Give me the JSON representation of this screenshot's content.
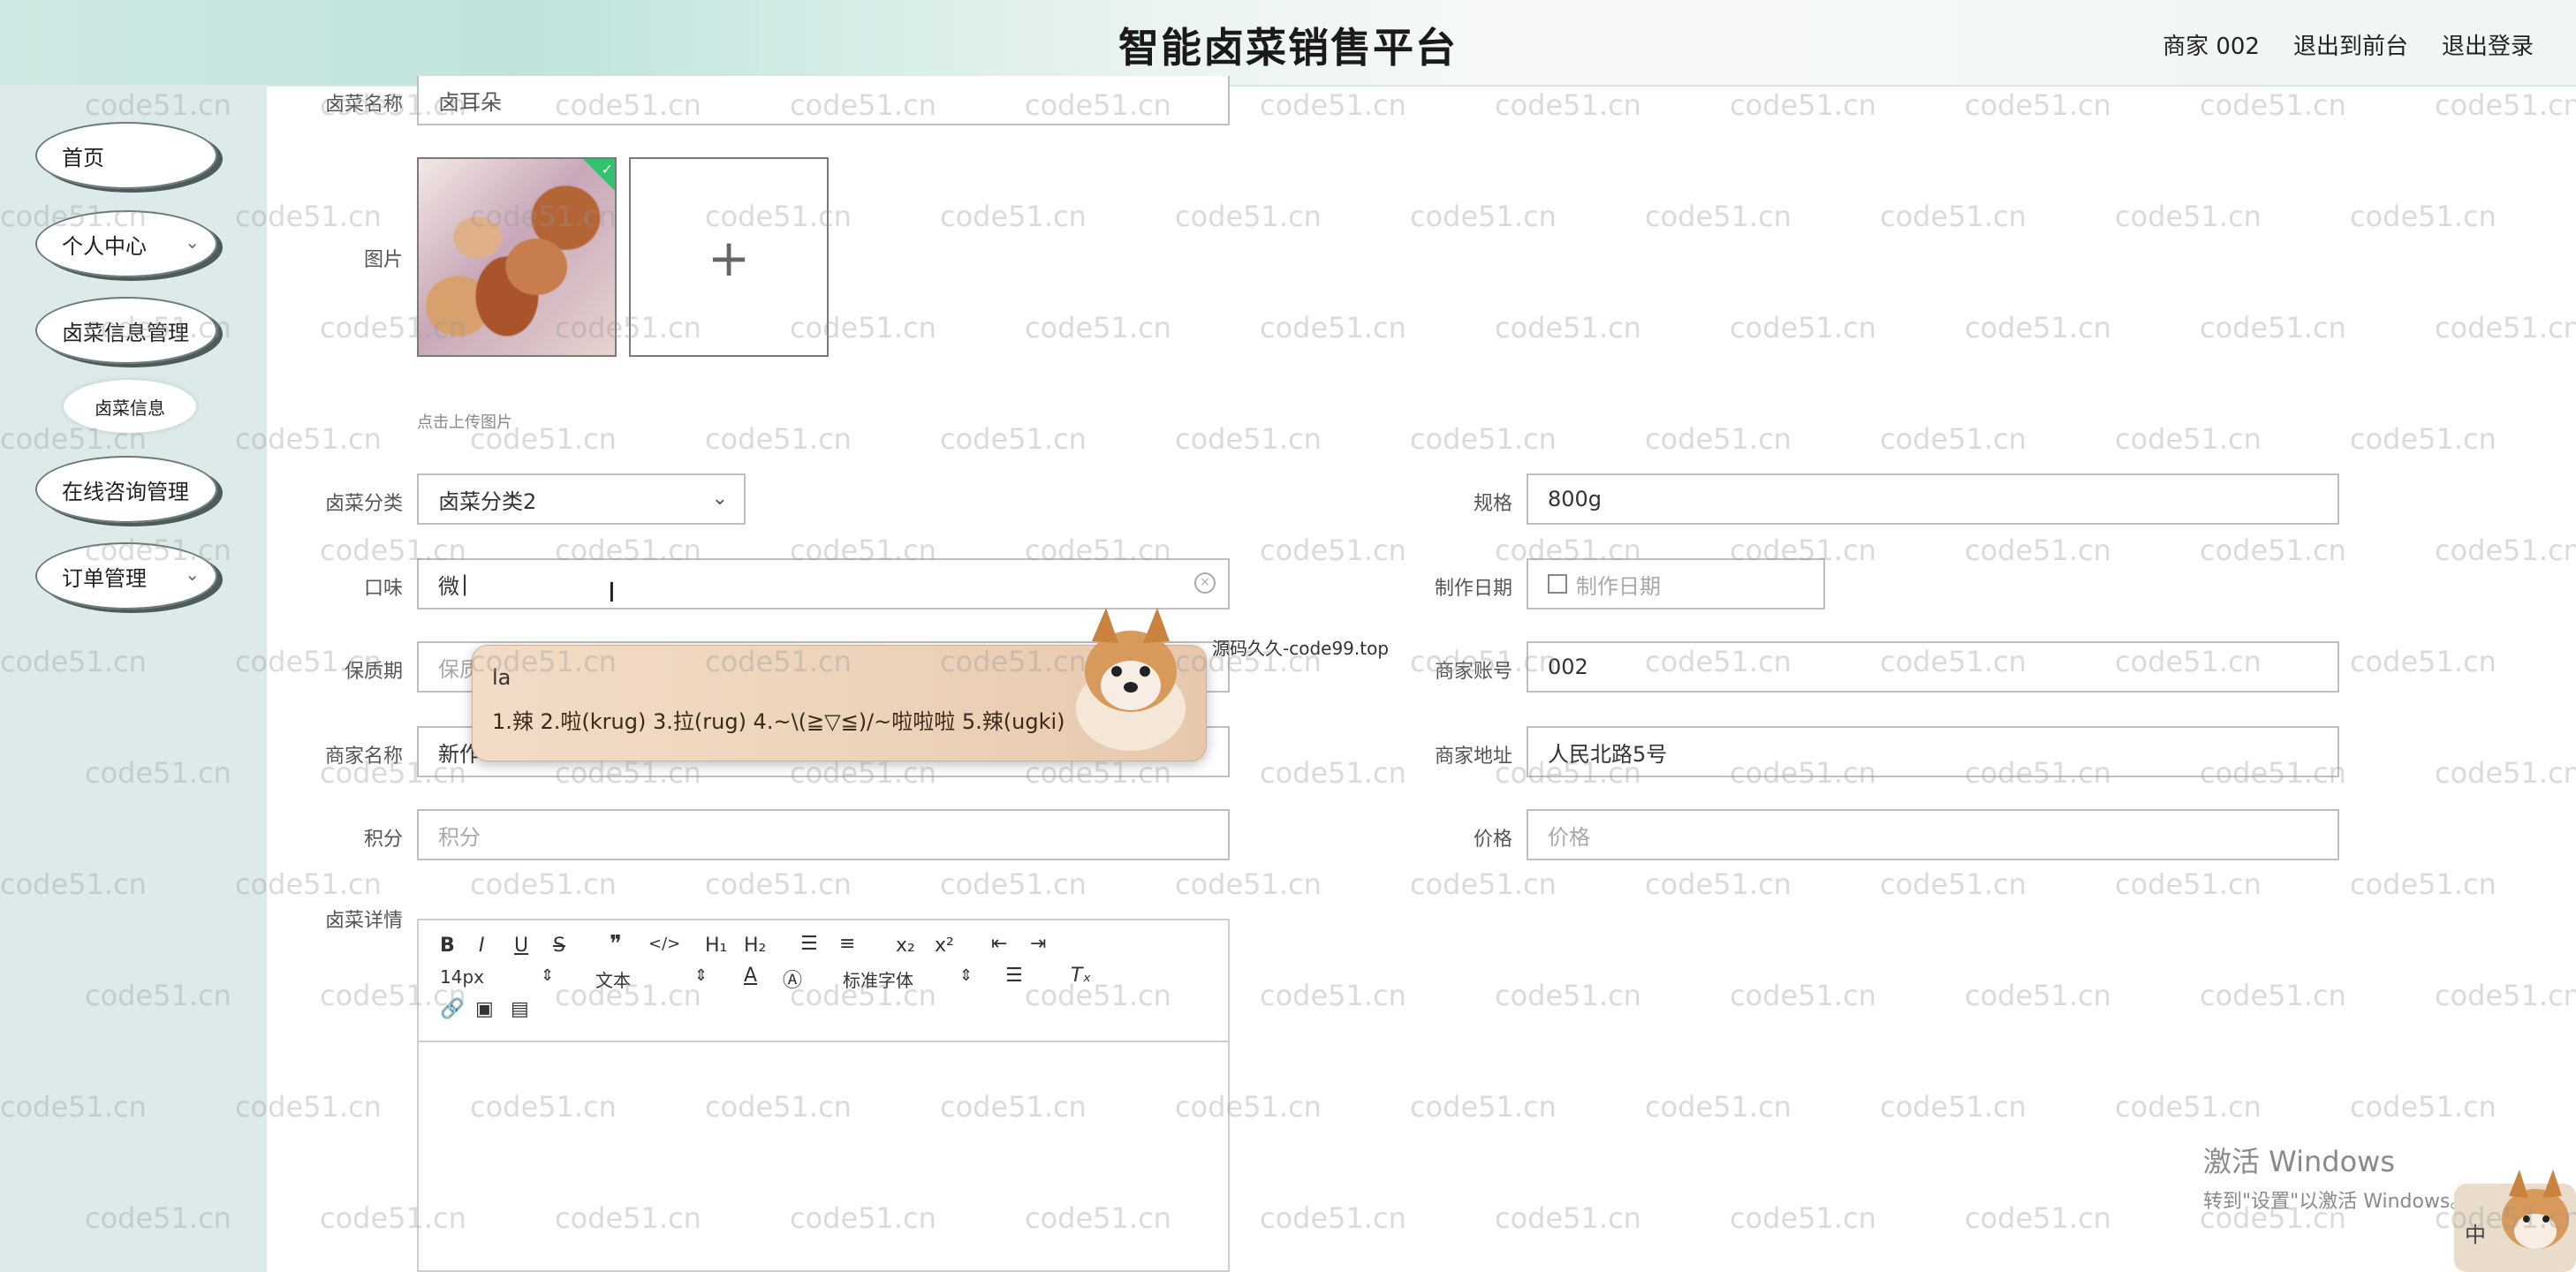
{
  "header": {
    "title": "智能卤菜销售平台",
    "user": "商家 002",
    "back_to_front": "退出到前台",
    "logout": "退出登录"
  },
  "sidebar": {
    "items": [
      {
        "label": "首页"
      },
      {
        "label": "个人中心"
      },
      {
        "label": "卤菜信息管理"
      },
      {
        "label": "在线咨询管理"
      },
      {
        "label": "订单管理"
      }
    ],
    "sub_item": "卤菜信息"
  },
  "form": {
    "name_label": "卤菜名称",
    "name_value": "卤耳朵",
    "image_label": "图片",
    "upload_hint": "点击上传图片",
    "category_label": "卤菜分类",
    "category_value": "卤菜分类2",
    "spec_label": "规格",
    "spec_value": "800g",
    "taste_label": "口味",
    "taste_value": "微",
    "made_date_label": "制作日期",
    "made_date_placeholder": "制作日期",
    "shelf_label": "保质期",
    "shelf_placeholder": "保质",
    "merchant_account_label": "商家账号",
    "merchant_account_value": "002",
    "merchant_name_label": "商家名称",
    "merchant_name_value": "新作",
    "merchant_address_label": "商家地址",
    "merchant_address_value": "人民北路5号",
    "points_label": "积分",
    "points_placeholder": "积分",
    "price_label": "价格",
    "price_placeholder": "价格",
    "detail_label": "卤菜详情"
  },
  "editor": {
    "size": "14px",
    "text_type": "文本",
    "font": "标准字体"
  },
  "ime": {
    "typed": "la",
    "candidates": "1.辣  2.啦(krug)  3.拉(rug)  4.~\\(≧▽≦)/~啦啦啦  5.辣(ugki)",
    "banner": "源码久久-code99.top",
    "mode": "中"
  },
  "windows": {
    "line1": "激活 Windows",
    "line2": "转到\"设置\"以激活 Windows。"
  },
  "watermark": "code51.cn"
}
